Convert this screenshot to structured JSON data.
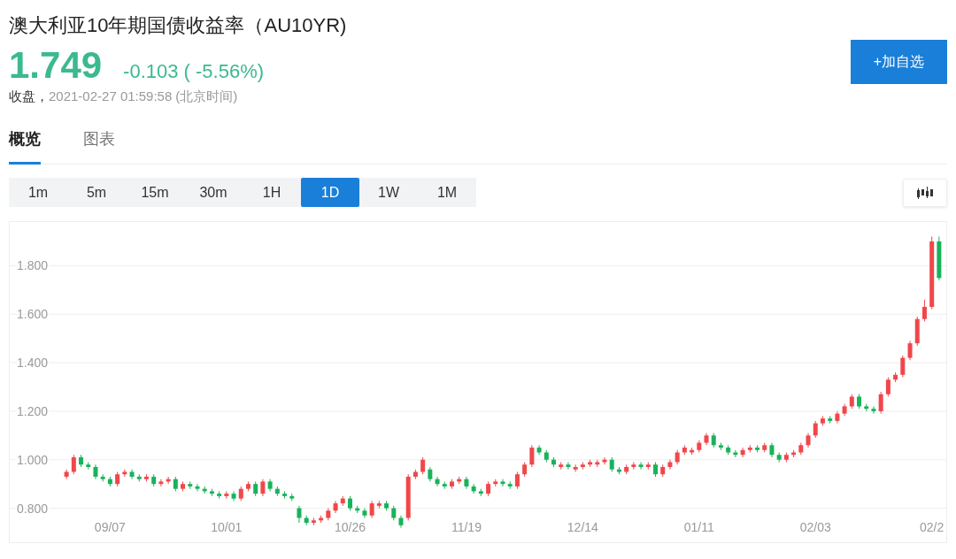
{
  "header": {
    "title": "澳大利亚10年期国债收益率（AU10YR)",
    "price": "1.749",
    "change": "-0.103 ( -5.56%)",
    "status": "收盘，",
    "time": "2021-02-27 01:59:58",
    "timezone": "(北京时间)",
    "watchlist_button": "+加自选"
  },
  "tabs": [
    {
      "label": "概览",
      "selected": true
    },
    {
      "label": "图表",
      "selected": false
    }
  ],
  "periods": [
    {
      "label": "1m",
      "selected": false
    },
    {
      "label": "5m",
      "selected": false
    },
    {
      "label": "15m",
      "selected": false
    },
    {
      "label": "30m",
      "selected": false
    },
    {
      "label": "1H",
      "selected": false
    },
    {
      "label": "1D",
      "selected": true
    },
    {
      "label": "1W",
      "selected": false
    },
    {
      "label": "1M",
      "selected": false
    }
  ],
  "chart": {
    "chart_data": {
      "type": "candlestick",
      "grid": true,
      "ylim": [
        0.66,
        1.98
      ],
      "yticks": [
        {
          "value": 0.8,
          "label": "0.800"
        },
        {
          "value": 1.0,
          "label": "1.000"
        },
        {
          "value": 1.2,
          "label": "1.200"
        },
        {
          "value": 1.4,
          "label": "1.400"
        },
        {
          "value": 1.6,
          "label": "1.600"
        },
        {
          "value": 1.8,
          "label": "1.800"
        }
      ],
      "categories": [
        null,
        null,
        null,
        null,
        null,
        null,
        "09/07",
        null,
        null,
        null,
        null,
        null,
        null,
        null,
        null,
        null,
        null,
        null,
        null,
        null,
        null,
        null,
        "10/01",
        null,
        null,
        null,
        null,
        null,
        null,
        null,
        null,
        null,
        null,
        null,
        null,
        null,
        null,
        null,
        null,
        "10/26",
        null,
        null,
        null,
        null,
        null,
        null,
        null,
        null,
        null,
        null,
        null,
        null,
        null,
        null,
        null,
        "11/19",
        null,
        null,
        null,
        null,
        null,
        null,
        null,
        null,
        null,
        null,
        null,
        null,
        null,
        null,
        null,
        "12/14",
        null,
        null,
        null,
        null,
        null,
        null,
        null,
        null,
        null,
        null,
        null,
        null,
        null,
        null,
        null,
        "01/11",
        null,
        null,
        null,
        null,
        null,
        null,
        null,
        null,
        null,
        null,
        null,
        null,
        null,
        null,
        null,
        "02/03",
        null,
        null,
        null,
        null,
        null,
        null,
        null,
        null,
        null,
        null,
        null,
        null,
        null,
        null,
        null,
        "02/2",
        null
      ],
      "ohlc": [
        [
          0.93,
          0.96,
          0.92,
          0.95
        ],
        [
          0.95,
          1.02,
          0.94,
          1.01
        ],
        [
          1.01,
          1.02,
          0.97,
          0.98
        ],
        [
          0.98,
          0.99,
          0.96,
          0.97
        ],
        [
          0.97,
          0.98,
          0.92,
          0.93
        ],
        [
          0.93,
          0.94,
          0.91,
          0.92
        ],
        [
          0.92,
          0.93,
          0.89,
          0.9
        ],
        [
          0.9,
          0.95,
          0.89,
          0.94
        ],
        [
          0.94,
          0.96,
          0.93,
          0.95
        ],
        [
          0.95,
          0.96,
          0.92,
          0.93
        ],
        [
          0.93,
          0.94,
          0.91,
          0.92
        ],
        [
          0.92,
          0.94,
          0.91,
          0.93
        ],
        [
          0.93,
          0.94,
          0.89,
          0.9
        ],
        [
          0.9,
          0.92,
          0.89,
          0.91
        ],
        [
          0.91,
          0.93,
          0.9,
          0.92
        ],
        [
          0.92,
          0.93,
          0.87,
          0.88
        ],
        [
          0.88,
          0.91,
          0.87,
          0.9
        ],
        [
          0.9,
          0.91,
          0.88,
          0.89
        ],
        [
          0.89,
          0.9,
          0.87,
          0.88
        ],
        [
          0.88,
          0.89,
          0.86,
          0.87
        ],
        [
          0.87,
          0.88,
          0.85,
          0.86
        ],
        [
          0.86,
          0.87,
          0.84,
          0.85
        ],
        [
          0.85,
          0.87,
          0.84,
          0.86
        ],
        [
          0.86,
          0.87,
          0.83,
          0.84
        ],
        [
          0.84,
          0.89,
          0.83,
          0.88
        ],
        [
          0.88,
          0.91,
          0.87,
          0.9
        ],
        [
          0.9,
          0.91,
          0.85,
          0.86
        ],
        [
          0.86,
          0.92,
          0.85,
          0.91
        ],
        [
          0.91,
          0.92,
          0.87,
          0.88
        ],
        [
          0.88,
          0.89,
          0.85,
          0.86
        ],
        [
          0.86,
          0.87,
          0.84,
          0.85
        ],
        [
          0.85,
          0.86,
          0.83,
          0.84
        ],
        [
          0.8,
          0.81,
          0.74,
          0.76
        ],
        [
          0.76,
          0.77,
          0.73,
          0.74
        ],
        [
          0.74,
          0.76,
          0.73,
          0.75
        ],
        [
          0.75,
          0.77,
          0.74,
          0.76
        ],
        [
          0.76,
          0.8,
          0.75,
          0.79
        ],
        [
          0.79,
          0.83,
          0.78,
          0.82
        ],
        [
          0.82,
          0.85,
          0.81,
          0.84
        ],
        [
          0.84,
          0.85,
          0.79,
          0.8
        ],
        [
          0.8,
          0.81,
          0.78,
          0.79
        ],
        [
          0.79,
          0.8,
          0.76,
          0.77
        ],
        [
          0.77,
          0.83,
          0.76,
          0.82
        ],
        [
          0.81,
          0.83,
          0.8,
          0.82
        ],
        [
          0.82,
          0.83,
          0.79,
          0.8
        ],
        [
          0.8,
          0.81,
          0.75,
          0.76
        ],
        [
          0.76,
          0.77,
          0.72,
          0.73
        ],
        [
          0.76,
          0.94,
          0.75,
          0.93
        ],
        [
          0.93,
          0.96,
          0.92,
          0.95
        ],
        [
          0.95,
          1.01,
          0.94,
          1.0
        ],
        [
          0.96,
          0.97,
          0.91,
          0.92
        ],
        [
          0.92,
          0.93,
          0.89,
          0.9
        ],
        [
          0.9,
          0.91,
          0.88,
          0.89
        ],
        [
          0.89,
          0.92,
          0.88,
          0.91
        ],
        [
          0.91,
          0.93,
          0.9,
          0.92
        ],
        [
          0.92,
          0.93,
          0.88,
          0.89
        ],
        [
          0.89,
          0.9,
          0.86,
          0.87
        ],
        [
          0.87,
          0.88,
          0.85,
          0.86
        ],
        [
          0.86,
          0.91,
          0.85,
          0.9
        ],
        [
          0.9,
          0.92,
          0.89,
          0.91
        ],
        [
          0.91,
          0.92,
          0.89,
          0.9
        ],
        [
          0.9,
          0.91,
          0.88,
          0.89
        ],
        [
          0.89,
          0.95,
          0.88,
          0.94
        ],
        [
          0.94,
          0.99,
          0.93,
          0.98
        ],
        [
          0.98,
          1.06,
          0.97,
          1.05
        ],
        [
          1.05,
          1.06,
          1.02,
          1.03
        ],
        [
          1.03,
          1.04,
          0.99,
          1.0
        ],
        [
          1.0,
          1.01,
          0.97,
          0.98
        ],
        [
          0.97,
          0.99,
          0.96,
          0.98
        ],
        [
          0.98,
          0.99,
          0.96,
          0.97
        ],
        [
          0.96,
          0.98,
          0.95,
          0.97
        ],
        [
          0.97,
          0.99,
          0.96,
          0.98
        ],
        [
          0.98,
          1.0,
          0.97,
          0.99
        ],
        [
          0.98,
          1.0,
          0.97,
          0.99
        ],
        [
          0.99,
          1.01,
          0.98,
          1.0
        ],
        [
          1.0,
          1.01,
          0.95,
          0.96
        ],
        [
          0.96,
          0.97,
          0.94,
          0.95
        ],
        [
          0.95,
          0.98,
          0.94,
          0.97
        ],
        [
          0.97,
          0.99,
          0.96,
          0.98
        ],
        [
          0.98,
          0.99,
          0.96,
          0.97
        ],
        [
          0.97,
          0.99,
          0.96,
          0.98
        ],
        [
          0.98,
          0.99,
          0.93,
          0.94
        ],
        [
          0.94,
          0.98,
          0.93,
          0.97
        ],
        [
          0.97,
          1.0,
          0.96,
          0.99
        ],
        [
          0.99,
          1.04,
          0.98,
          1.03
        ],
        [
          1.03,
          1.06,
          1.02,
          1.05
        ],
        [
          1.03,
          1.05,
          1.02,
          1.04
        ],
        [
          1.04,
          1.08,
          1.03,
          1.07
        ],
        [
          1.07,
          1.11,
          1.06,
          1.1
        ],
        [
          1.1,
          1.11,
          1.05,
          1.06
        ],
        [
          1.06,
          1.07,
          1.04,
          1.05
        ],
        [
          1.05,
          1.06,
          1.02,
          1.03
        ],
        [
          1.03,
          1.04,
          1.01,
          1.02
        ],
        [
          1.02,
          1.05,
          1.01,
          1.04
        ],
        [
          1.04,
          1.06,
          1.03,
          1.05
        ],
        [
          1.05,
          1.06,
          1.03,
          1.04
        ],
        [
          1.04,
          1.07,
          1.03,
          1.06
        ],
        [
          1.06,
          1.07,
          1.01,
          1.02
        ],
        [
          1.02,
          1.03,
          0.99,
          1.0
        ],
        [
          1.0,
          1.03,
          0.99,
          1.02
        ],
        [
          1.02,
          1.04,
          1.01,
          1.03
        ],
        [
          1.03,
          1.07,
          1.02,
          1.06
        ],
        [
          1.06,
          1.11,
          1.05,
          1.1
        ],
        [
          1.1,
          1.16,
          1.09,
          1.15
        ],
        [
          1.15,
          1.18,
          1.14,
          1.17
        ],
        [
          1.17,
          1.18,
          1.15,
          1.16
        ],
        [
          1.16,
          1.2,
          1.15,
          1.19
        ],
        [
          1.19,
          1.23,
          1.18,
          1.22
        ],
        [
          1.22,
          1.27,
          1.21,
          1.26
        ],
        [
          1.26,
          1.27,
          1.21,
          1.22
        ],
        [
          1.22,
          1.23,
          1.2,
          1.21
        ],
        [
          1.21,
          1.22,
          1.19,
          1.2
        ],
        [
          1.2,
          1.28,
          1.19,
          1.27
        ],
        [
          1.27,
          1.34,
          1.26,
          1.33
        ],
        [
          1.33,
          1.36,
          1.32,
          1.35
        ],
        [
          1.35,
          1.43,
          1.34,
          1.42
        ],
        [
          1.42,
          1.49,
          1.41,
          1.48
        ],
        [
          1.48,
          1.59,
          1.47,
          1.58
        ],
        [
          1.58,
          1.66,
          1.57,
          1.63
        ],
        [
          1.63,
          1.92,
          1.62,
          1.9
        ],
        [
          1.9,
          1.92,
          1.74,
          1.749
        ]
      ]
    }
  }
}
